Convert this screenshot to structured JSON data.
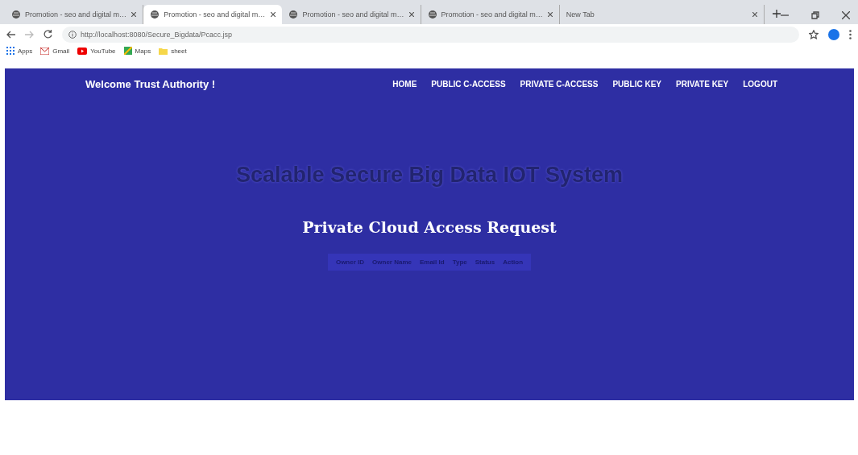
{
  "browser": {
    "tabs": [
      {
        "title": "Promotion - seo and digital m…",
        "selected": false
      },
      {
        "title": "Promotion - seo and digital m…",
        "selected": true
      },
      {
        "title": "Promotion - seo and digital m…",
        "selected": false
      },
      {
        "title": "Promotion - seo and digital m…",
        "selected": false
      },
      {
        "title": "New Tab",
        "selected": false
      }
    ],
    "url": "http://localhost:8080/Secure_Bigdata/Pcacc.jsp",
    "bookmarks": [
      {
        "label": "Apps",
        "kind": "apps"
      },
      {
        "label": "Gmail",
        "kind": "gmail"
      },
      {
        "label": "YouTube",
        "kind": "youtube"
      },
      {
        "label": "Maps",
        "kind": "maps"
      },
      {
        "label": "sheet",
        "kind": "folder"
      }
    ]
  },
  "page": {
    "brand": "Welcome Trust Authority !",
    "nav": [
      "HOME",
      "PUBLIC C-ACCESS",
      "PRIVATE C-ACCESS",
      "PUBLIC KEY",
      "PRIVATE KEY",
      "LOGOUT"
    ],
    "title": "Scalable Secure Big Data IOT System",
    "subtitle": "Private Cloud Access Request",
    "table": {
      "columns": [
        "Owner ID",
        "Owner Name",
        "Email Id",
        "Type",
        "Status",
        "Action"
      ]
    }
  }
}
